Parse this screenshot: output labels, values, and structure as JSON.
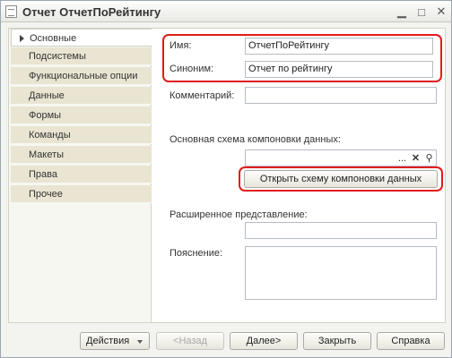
{
  "window": {
    "title": "Отчет ОтчетПоРейтингу",
    "controls": {
      "minimize": "▁",
      "maximize": "□",
      "close": "✕"
    }
  },
  "tabs": [
    {
      "label": "Основные",
      "active": true
    },
    {
      "label": "Подсистемы"
    },
    {
      "label": "Функциональные опции"
    },
    {
      "label": "Данные"
    },
    {
      "label": "Формы"
    },
    {
      "label": "Команды"
    },
    {
      "label": "Макеты"
    },
    {
      "label": "Права"
    },
    {
      "label": "Прочее"
    }
  ],
  "form": {
    "name_label": "Имя:",
    "name_value": "ОтчетПоРейтингу",
    "synonym_label": "Синоним:",
    "synonym_value": "Отчет по рейтингу",
    "comment_label": "Комментарий:",
    "comment_value": "",
    "schema_label": "Основная схема компоновки данных:",
    "schema_value": "",
    "schema_select_icon": "...",
    "schema_clear_icon": "✕",
    "schema_open_icon": "⚲",
    "open_schema_button": "Открыть схему компоновки данных",
    "extended_label": "Расширенное представление:",
    "extended_value": "",
    "explanation_label": "Пояснение:",
    "explanation_value": ""
  },
  "footer": {
    "actions": "Действия",
    "back": "<Назад",
    "next": "Далее>",
    "close": "Закрыть",
    "help": "Справка"
  },
  "colors": {
    "highlight": "#e21b1b",
    "tab_inactive": "#e9e5d2",
    "window_bg": "#f3f3ef"
  }
}
